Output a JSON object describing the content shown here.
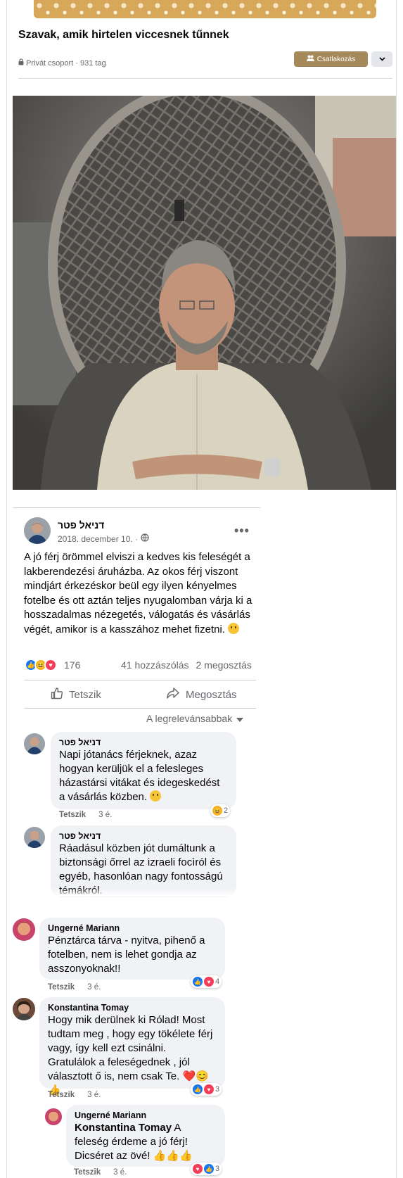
{
  "group": {
    "title": "Szavak, amik hirtelen viccesnek tűnnek",
    "meta": "Privát csoport · 931 tag",
    "join_label": "Csatlakozás",
    "more_icon": "chevron-down-icon"
  },
  "post": {
    "author": "דניאל פטר",
    "date": "2018. december 10. ·",
    "text": "A jó férj örömmel elviszi a kedves kis feleségét a lakberendezési áruházba. Az okos férj viszont mindjárt érkezéskor beül egy ilyen kényelmes fotelbe és ott aztán teljes nyugalomban várja ki a hosszadalmas nézegetés, válogatás és vásárlás végét, amikor is a kasszához mehet fizetni.",
    "reaction_count": "176",
    "comments": "41 hozzászólás",
    "shares": "2 megosztás",
    "like_label": "Tetszik",
    "share_label": "Megosztás",
    "sort_label": "A legrelevánsabbak"
  },
  "comments": [
    {
      "author": "דניאל פטר",
      "text": "Napi jótanács férjeknek, azaz hogyan kerüljük el a felesleges házastársi vitákat és idegeskedést a vásárlás közben.",
      "like": "Tetszik",
      "time": "3 é.",
      "react_count": "2"
    },
    {
      "author": "דניאל פטר",
      "text": "Ráadásul közben jót dumáltunk a biztonsági őrrel az izraeli focìról és egyéb, hasonlóan nagy fontosságú témákról."
    },
    {
      "author": "Ungerné Mariann",
      "text": "Pénztárca tárva - nyitva, pihenő a fotelben, nem is lehet gondja az asszonyoknak!!",
      "like": "Tetszik",
      "time": "3 é.",
      "react_count": "4"
    },
    {
      "author": "Konstantina Tomay",
      "text": "Hogy mik derülnek ki Rólad! Most tudtam meg , hogy egy tökélete férj vagy, így kell ezt csinálni. Gratulálok a feleségednek , jól választott ő is, nem csak Te.",
      "emojis": "❤️😊👍",
      "like": "Tetszik",
      "time": "3 é.",
      "react_count": "3"
    },
    {
      "author": "Ungerné Mariann",
      "mention": "Konstantina Tomay",
      "text": "A feleség érdeme a jó férj! Dicséret az övé!",
      "emojis": "👍👍👍",
      "like": "Tetszik",
      "time": "3 é.",
      "react_count": "3"
    }
  ]
}
